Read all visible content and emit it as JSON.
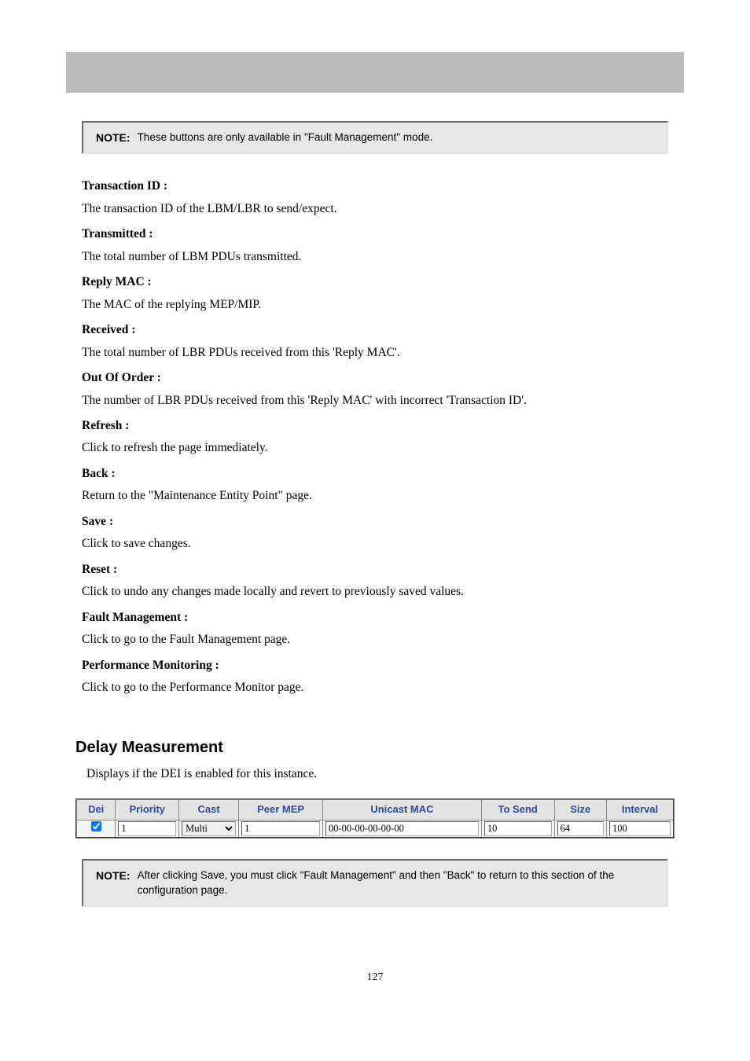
{
  "note1": {
    "label": "NOTE:",
    "text": "These buttons are only available in \"Fault Management\" mode."
  },
  "definitions": [
    {
      "term": "Transaction ID :",
      "desc": "The transaction ID of the LBM/LBR to send/expect."
    },
    {
      "term": "Transmitted :",
      "desc": "The total number of LBM PDUs transmitted."
    },
    {
      "term": "Reply MAC :",
      "desc": "The MAC of the replying MEP/MIP."
    },
    {
      "term": "Received :",
      "desc": "The total number of LBR PDUs received from this 'Reply MAC'."
    },
    {
      "term": "Out Of Order :",
      "desc": "The number of LBR PDUs received from this 'Reply MAC' with incorrect 'Transaction ID'."
    },
    {
      "term": "Refresh :",
      "desc": "Click to refresh the page immediately."
    },
    {
      "term": "Back :",
      "desc": "Return to the \"Maintenance Entity Point\" page."
    },
    {
      "term": "Save :",
      "desc": "Click to save changes."
    },
    {
      "term": "Reset :",
      "desc": "Click to undo any changes made locally and revert to previously saved values."
    },
    {
      "term": "Fault Management :",
      "desc": "Click to go to the Fault Management page."
    },
    {
      "term": "Performance Monitoring :",
      "desc": "Click to go to the Performance Monitor page."
    }
  ],
  "section": {
    "heading": "Delay Measurement",
    "sub": "Displays if the DEI is enabled for this instance."
  },
  "table": {
    "headers": [
      "Dei",
      "Priority",
      "Cast",
      "Peer MEP",
      "Unicast MAC",
      "To Send",
      "Size",
      "Interval"
    ],
    "row": {
      "dei_checked": true,
      "priority": "1",
      "cast_options": [
        "Multi"
      ],
      "cast_selected": "Multi",
      "peer_mep": "1",
      "unicast_mac": "00-00-00-00-00-00",
      "to_send": "10",
      "size": "64",
      "interval": "100"
    }
  },
  "note2": {
    "label": "NOTE:",
    "text": "After clicking Save, you must click \"Fault Management\" and then \"Back\" to return to this section of the configuration page."
  },
  "page_number": "127"
}
